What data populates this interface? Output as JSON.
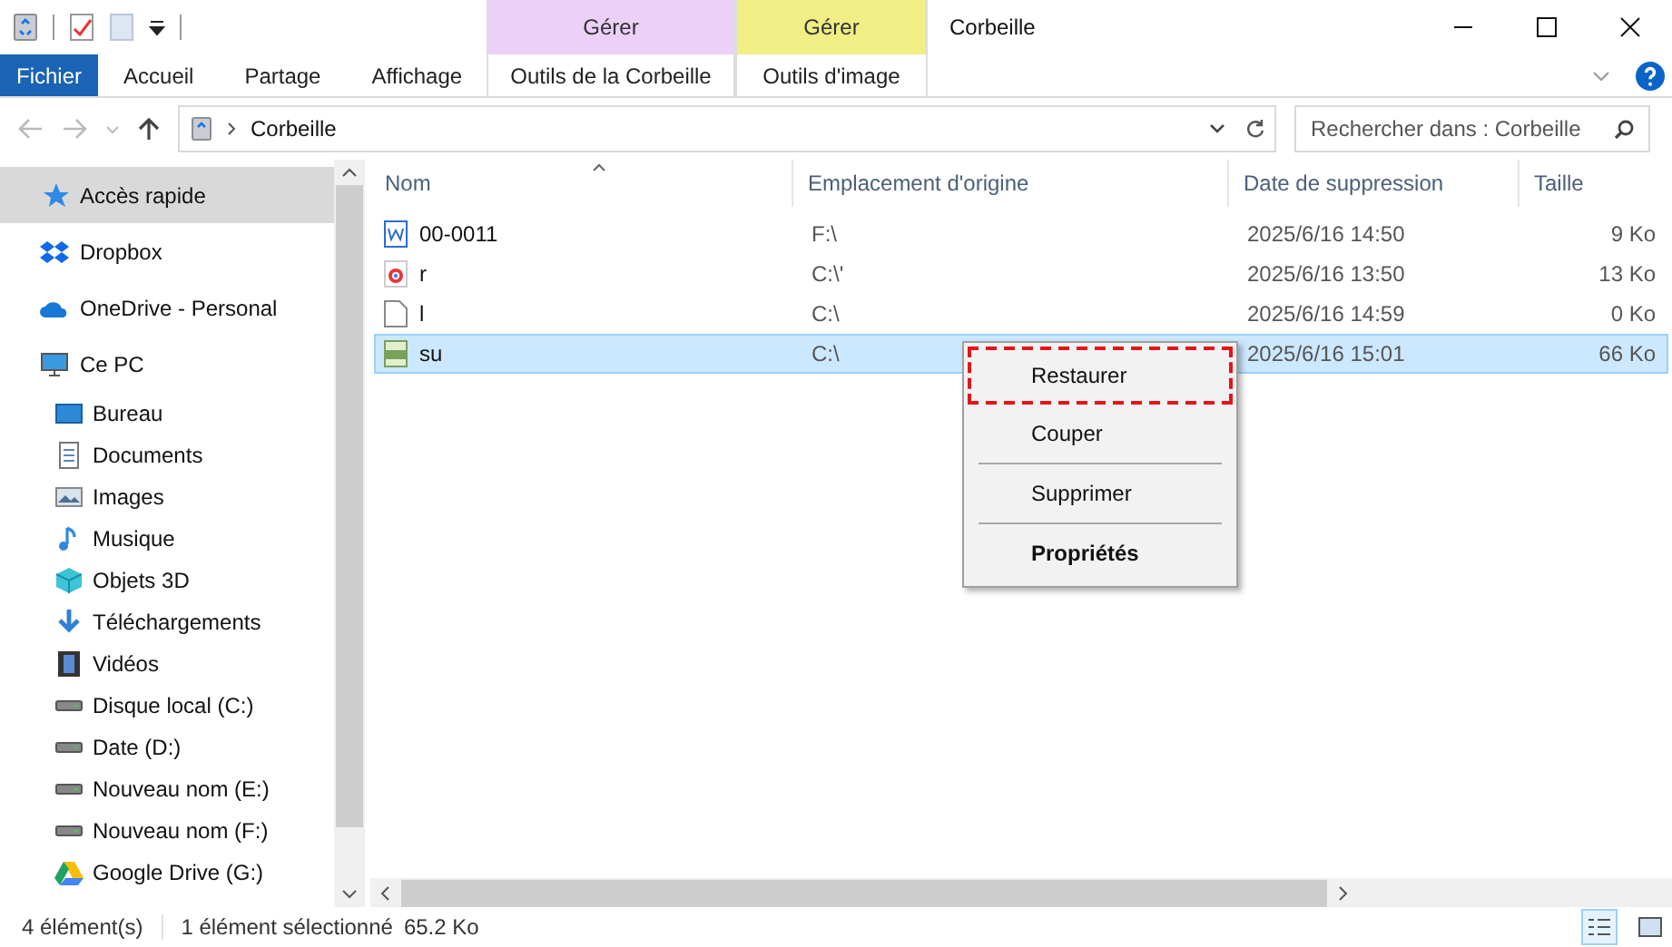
{
  "window": {
    "title": "Corbeille"
  },
  "ribbon": {
    "tabs": [
      {
        "label": "Fichier",
        "selected": true
      },
      {
        "label": "Accueil",
        "selected": false
      },
      {
        "label": "Partage",
        "selected": false
      },
      {
        "label": "Affichage",
        "selected": false
      }
    ],
    "context_groups": [
      {
        "header": "Gérer",
        "tab": "Outils de la Corbeille",
        "color": "#ecd0f8"
      },
      {
        "header": "Gérer",
        "tab": "Outils d'image",
        "color": "#f0ee84"
      }
    ]
  },
  "address": {
    "location": "Corbeille",
    "search_placeholder": "Rechercher dans : Corbeille"
  },
  "sidebar": {
    "items": [
      {
        "label": "Accès rapide",
        "kind": "star",
        "selected": true
      },
      {
        "label": "Dropbox",
        "kind": "dropbox",
        "selected": false
      },
      {
        "label": "OneDrive - Personal",
        "kind": "cloud",
        "selected": false
      },
      {
        "label": "Ce PC",
        "kind": "pc",
        "selected": false,
        "children": [
          {
            "label": "Bureau",
            "kind": "desktop",
            "selected": false
          },
          {
            "label": "Documents",
            "kind": "doc",
            "selected": false
          },
          {
            "label": "Images",
            "kind": "image",
            "selected": false
          },
          {
            "label": "Musique",
            "kind": "music",
            "selected": false
          },
          {
            "label": "Objets 3D",
            "kind": "cube",
            "selected": false
          },
          {
            "label": "Téléchargements",
            "kind": "download",
            "selected": false
          },
          {
            "label": "Vidéos",
            "kind": "video",
            "selected": false
          },
          {
            "label": "Disque local (C:)",
            "kind": "drive",
            "selected": false
          },
          {
            "label": "Date (D:)",
            "kind": "drive",
            "selected": false
          },
          {
            "label": "Nouveau nom (E:)",
            "kind": "drive",
            "selected": false
          },
          {
            "label": "Nouveau nom (F:)",
            "kind": "drive",
            "selected": false
          },
          {
            "label": "Google Drive (G:)",
            "kind": "gdrive",
            "selected": false
          }
        ]
      }
    ]
  },
  "table": {
    "columns": [
      "Nom",
      "Emplacement d'origine",
      "Date de suppression",
      "Taille"
    ],
    "rows": [
      {
        "kind": "word",
        "name": "00-0011",
        "location": "F:\\",
        "date": "2025/6/16 14:50",
        "size": "9 Ko",
        "selected": false
      },
      {
        "kind": "chrome",
        "name": "r",
        "location": "C:\\'",
        "date": "2025/6/16 13:50",
        "size": "13 Ko",
        "selected": false
      },
      {
        "kind": "blank",
        "name": "l",
        "location": "C:\\",
        "date": "2025/6/16 14:59",
        "size": "0 Ko",
        "selected": false
      },
      {
        "kind": "png",
        "name": "su",
        "location": "C:\\",
        "date": "2025/6/16 15:01",
        "size": "66 Ko",
        "selected": true
      }
    ]
  },
  "context_menu": {
    "items": [
      {
        "label": "Restaurer",
        "highlighted": true,
        "bold": false,
        "separator_before": false
      },
      {
        "label": "Couper",
        "highlighted": false,
        "bold": false,
        "separator_before": false
      },
      {
        "label": "Supprimer",
        "highlighted": false,
        "bold": false,
        "separator_before": true
      },
      {
        "label": "Propriétés",
        "highlighted": false,
        "bold": true,
        "separator_before": true
      }
    ]
  },
  "status_bar": {
    "count": "4 élément(s)",
    "selection": "1 élément sélectionné",
    "size": "65.2 Ko",
    "views": [
      {
        "kind": "details",
        "selected": true
      },
      {
        "kind": "thumbs",
        "selected": false
      }
    ]
  }
}
